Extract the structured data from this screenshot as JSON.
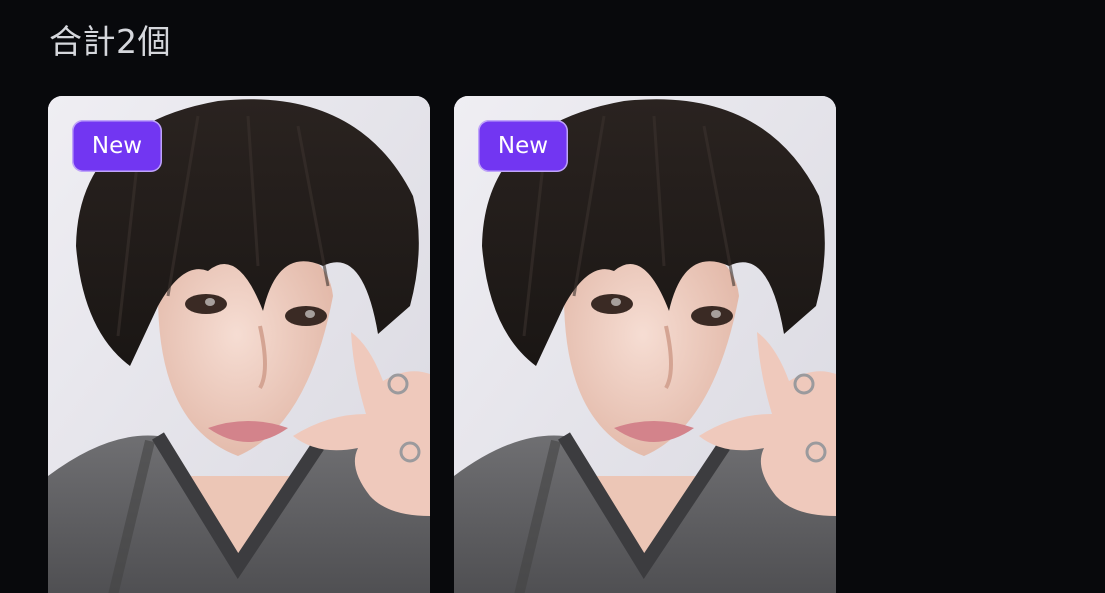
{
  "header": {
    "total_label": "合計2個"
  },
  "cards": [
    {
      "badge": "New",
      "image": "portrait-photo"
    },
    {
      "badge": "New",
      "image": "portrait-photo"
    }
  ],
  "colors": {
    "background": "#08090c",
    "badge": "#7236f2",
    "text": "#d5d7dc"
  }
}
